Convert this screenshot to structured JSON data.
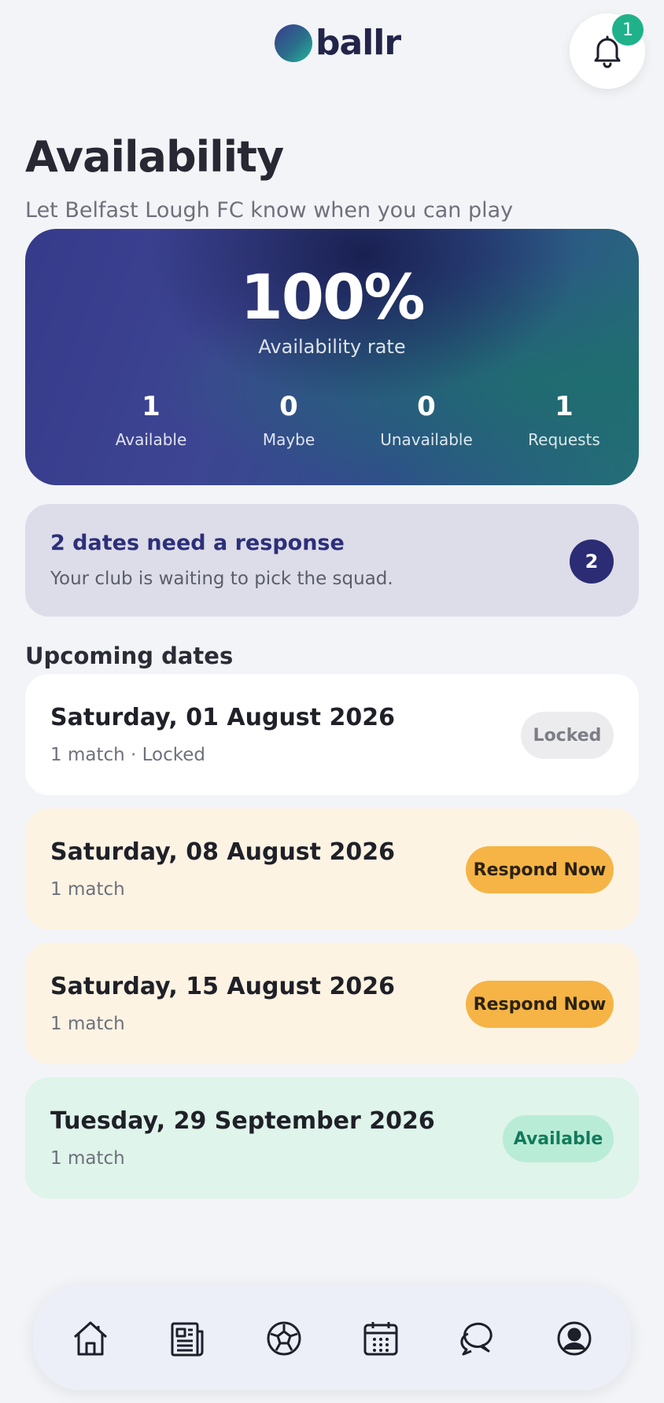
{
  "header": {
    "logo_text": "ballr",
    "notification_count": "1",
    "logo_gradient": [
      "#3b3b8f",
      "#2a6f8a",
      "#25b79a"
    ]
  },
  "page": {
    "title": "Availability",
    "subtitle": "Let Belfast Lough FC know when you can play"
  },
  "stats": {
    "rate_value": "100%",
    "rate_label": "Availability rate",
    "items": [
      {
        "value": "1",
        "label": "Available"
      },
      {
        "value": "0",
        "label": "Maybe"
      },
      {
        "value": "0",
        "label": "Unavailable"
      },
      {
        "value": "1",
        "label": "Requests"
      }
    ]
  },
  "response": {
    "title": "2 dates need a response",
    "subtitle": "Your club is waiting to pick the squad.",
    "count": "2"
  },
  "upcoming": {
    "section_title": "Upcoming dates",
    "dates": [
      {
        "title": "Saturday, 01 August 2026",
        "subtitle": "1 match · Locked",
        "status": "Locked",
        "bg": "#ffffff"
      },
      {
        "title": "Saturday, 08 August 2026",
        "subtitle": "1 match",
        "status": "Respond Now",
        "bg": "#fdf3e3"
      },
      {
        "title": "Saturday, 15 August 2026",
        "subtitle": "1 match",
        "status": "Respond Now",
        "bg": "#fdf3e3"
      },
      {
        "title": "Tuesday, 29 September 2026",
        "subtitle": "1 match",
        "status": "Available",
        "bg": "#dff4ea"
      }
    ]
  },
  "nav": {
    "items": [
      "home-icon",
      "news-icon",
      "football-icon",
      "calendar-icon",
      "chat-icon",
      "profile-icon"
    ]
  },
  "colors": {
    "accent_navy": "#2b2c74",
    "respond_orange": "#f5b445",
    "available_green": "#1fb28a"
  }
}
